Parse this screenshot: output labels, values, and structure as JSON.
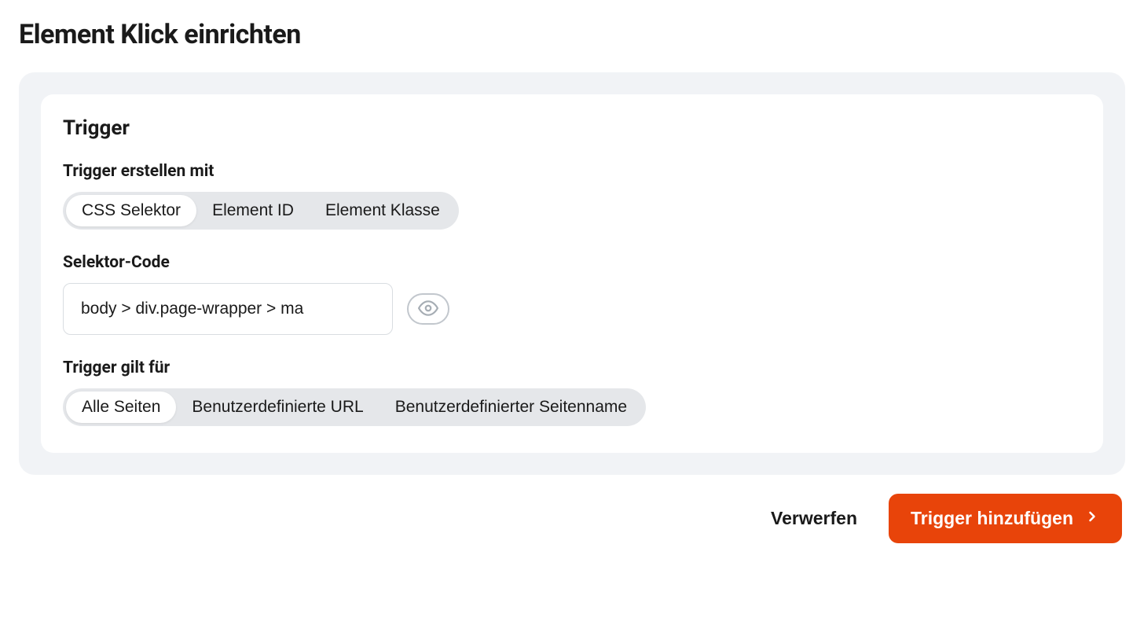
{
  "page": {
    "title": "Element Klick einrichten"
  },
  "card": {
    "title": "Trigger",
    "createWith": {
      "label": "Trigger erstellen mit",
      "options": [
        "CSS Selektor",
        "Element ID",
        "Element Klasse"
      ],
      "selected": 0
    },
    "selectorCode": {
      "label": "Selektor-Code",
      "value": "body > div.page-wrapper > ma"
    },
    "appliesTo": {
      "label": "Trigger gilt für",
      "options": [
        "Alle Seiten",
        "Benutzerdefinierte URL",
        "Benutzerdefinierter Seitenname"
      ],
      "selected": 0
    }
  },
  "footer": {
    "discard": "Verwerfen",
    "add": "Trigger hinzufügen"
  }
}
